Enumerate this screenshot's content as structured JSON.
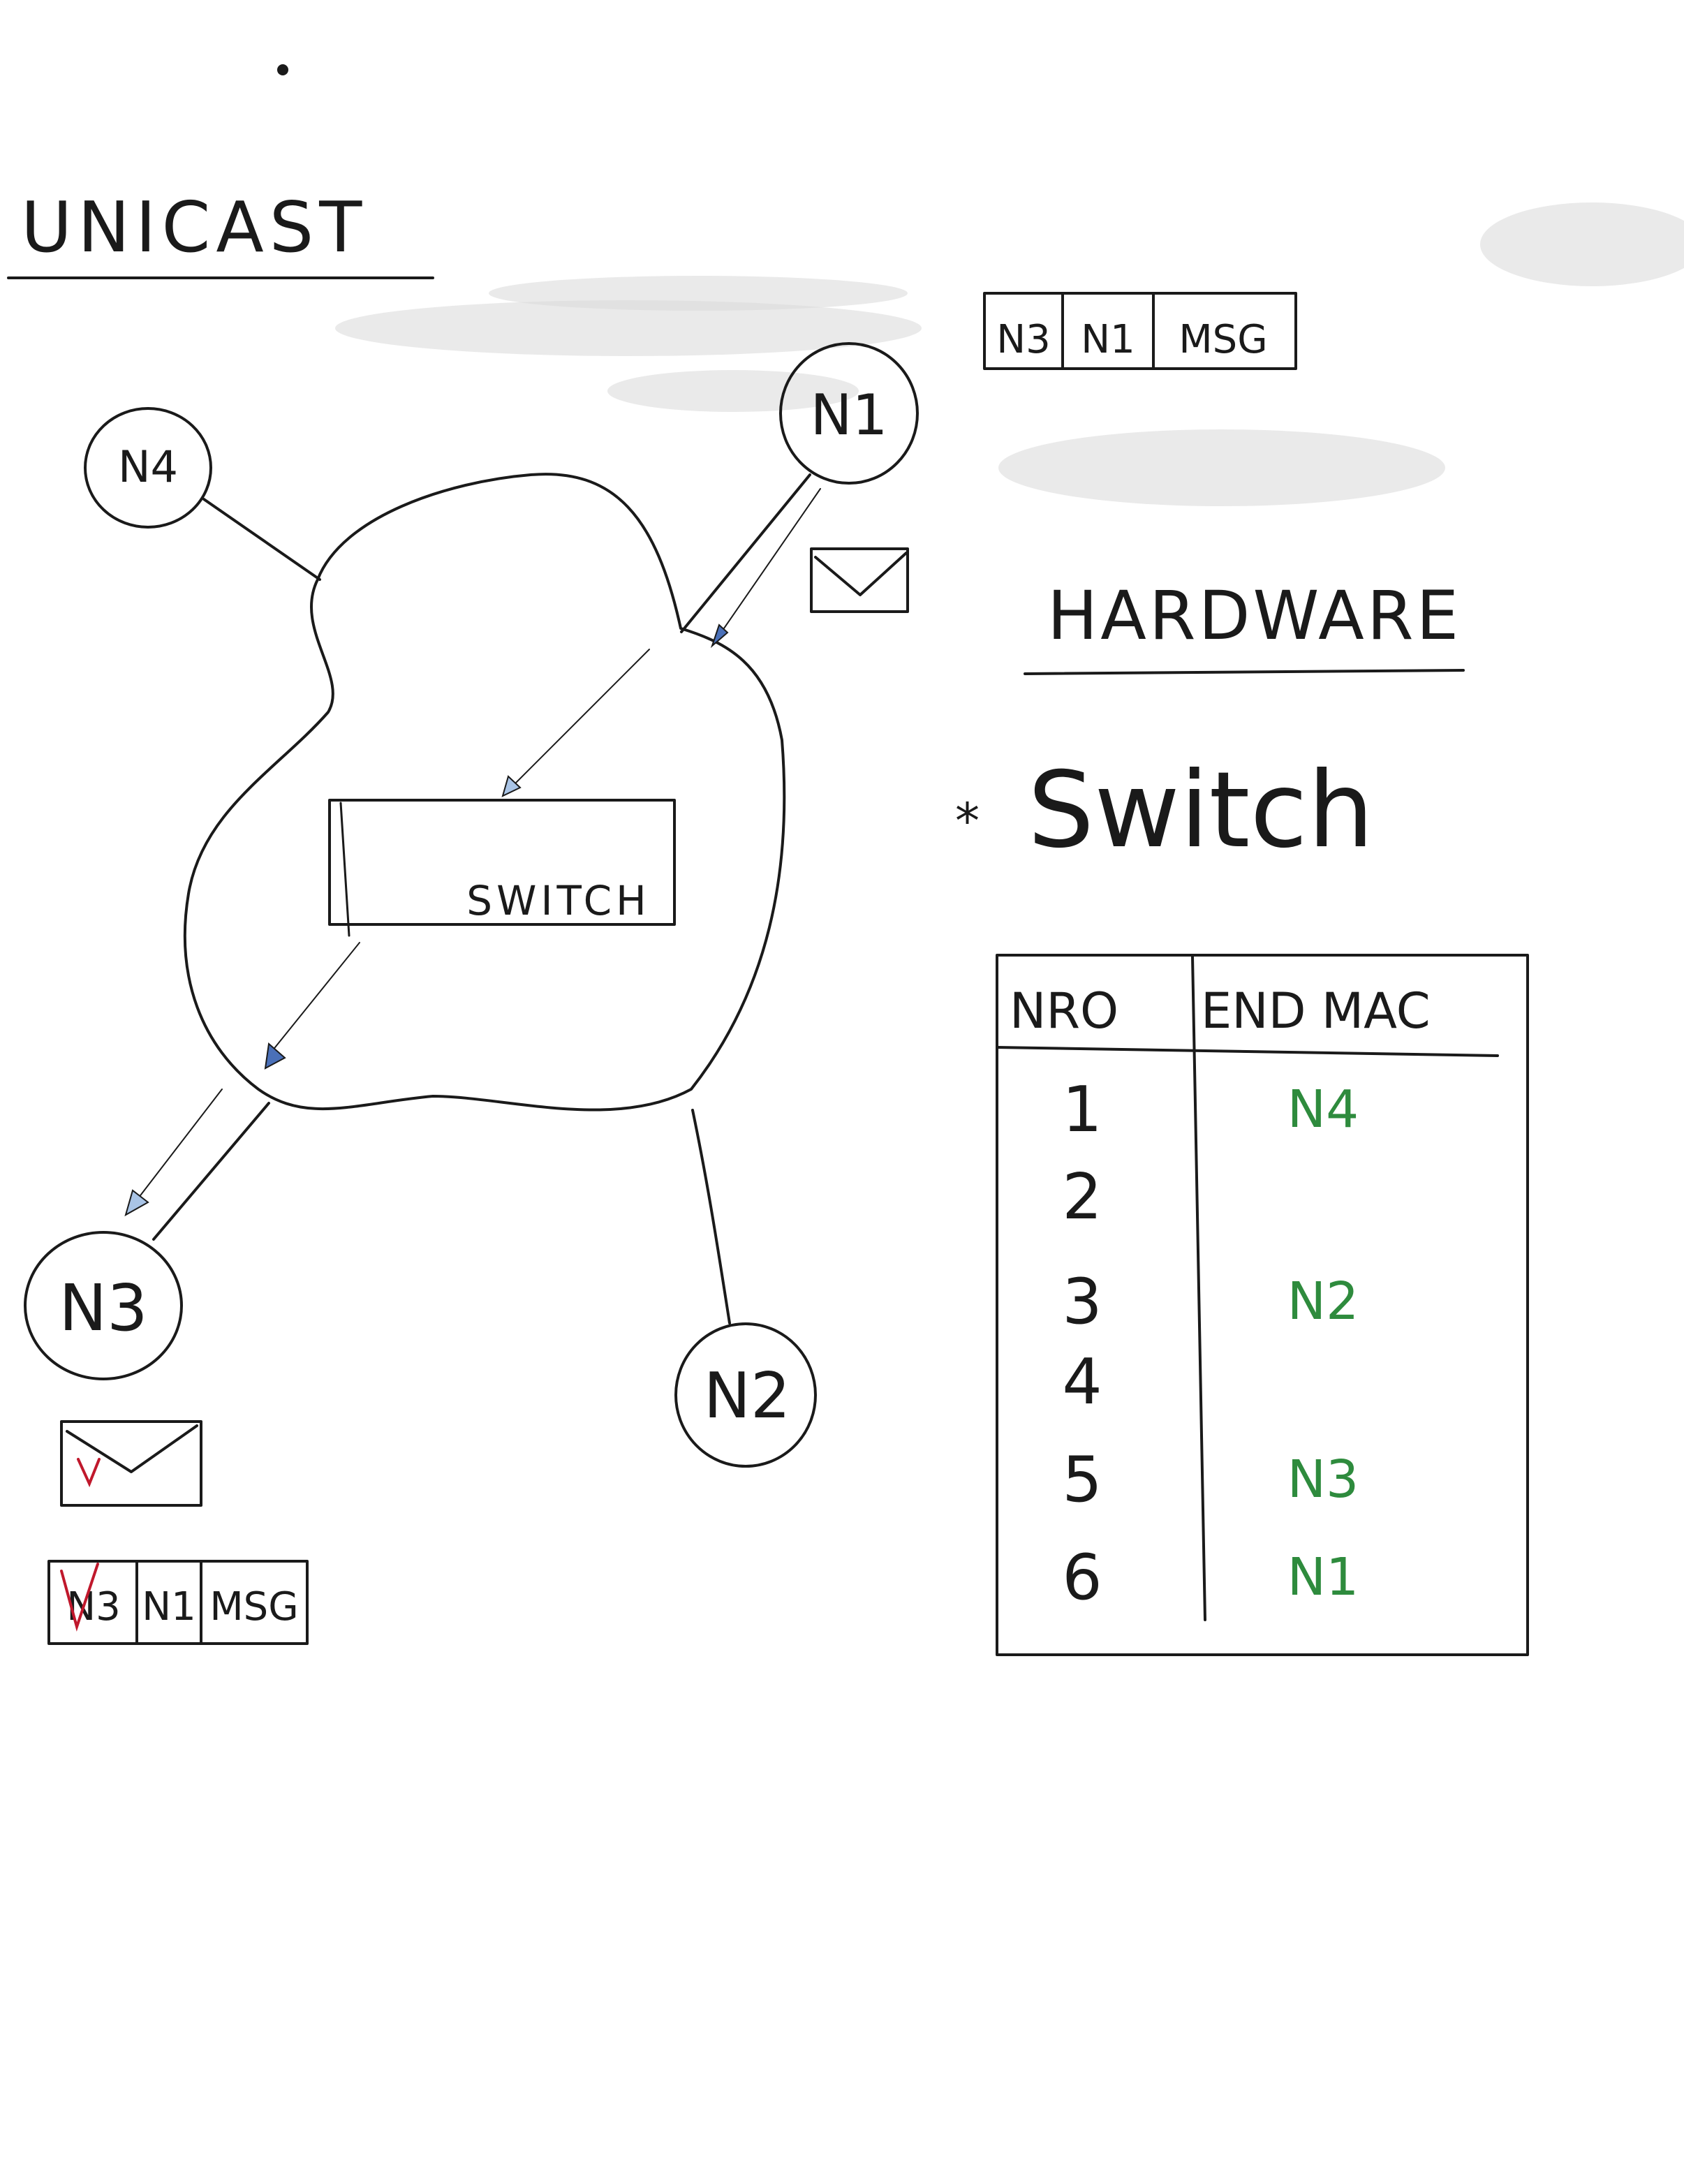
{
  "colors": {
    "ink": "#1a1a1a",
    "green_ink": "#2e8b3d",
    "red_ink": "#c0182c",
    "arrow_blue": "#4a70b8",
    "board": "#ffffff"
  },
  "title": "UNICAST",
  "nodes": {
    "n1": "N1",
    "n2": "N2",
    "n3": "N3",
    "n4": "N4"
  },
  "switch_label": "SWITCH",
  "frame_top": [
    "N3",
    "N1",
    "MSG"
  ],
  "frame_bottom": [
    "N3",
    "N1",
    "MSG"
  ],
  "hardware": {
    "heading": "HARDWARE",
    "bullet": "*",
    "item": "Switch"
  },
  "table": {
    "headers": [
      "NRO",
      "END MAC"
    ],
    "rows": [
      {
        "nro": "1",
        "mac": "N4"
      },
      {
        "nro": "2",
        "mac": ""
      },
      {
        "nro": "3",
        "mac": "N2"
      },
      {
        "nro": "4",
        "mac": ""
      },
      {
        "nro": "5",
        "mac": "N3"
      },
      {
        "nro": "6",
        "mac": "N1"
      }
    ]
  },
  "icons": [
    "envelope-icon",
    "checkmark-icon",
    "arrow-icon"
  ]
}
